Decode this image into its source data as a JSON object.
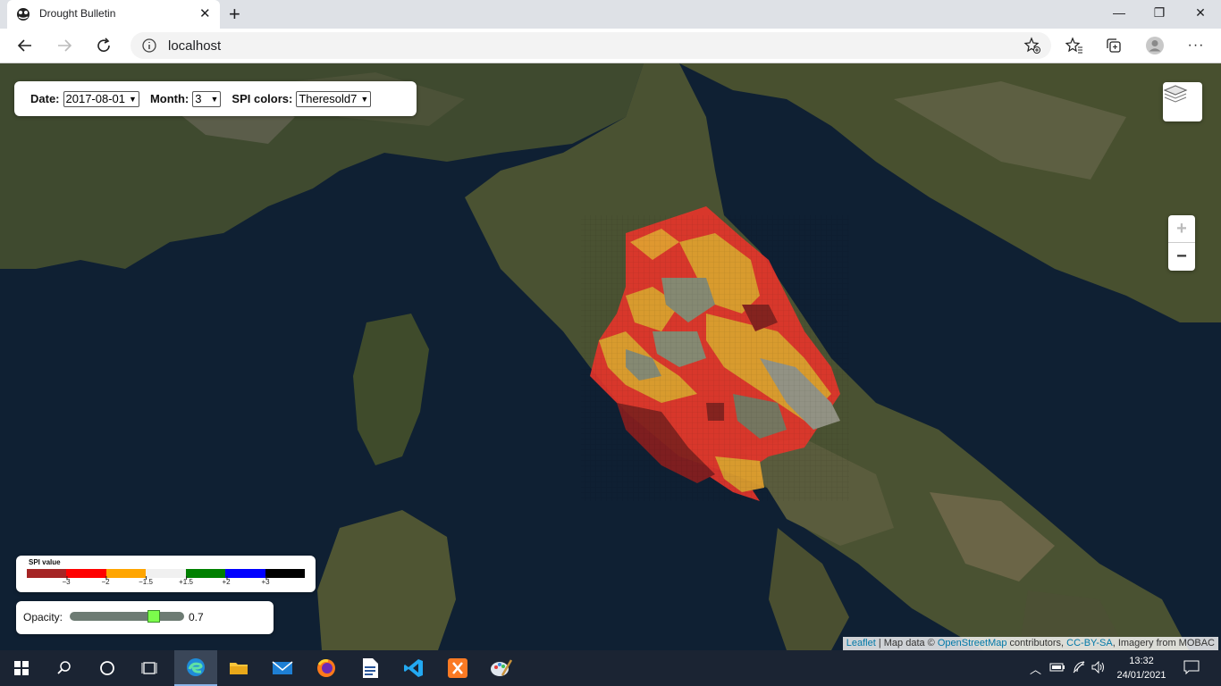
{
  "browser": {
    "tab_title": "Drought Bulletin",
    "address": "localhost"
  },
  "controls": {
    "date_label": "Date:",
    "date_value": "2017-08-01",
    "month_label": "Month:",
    "month_value": "3",
    "spi_label": "SPI colors:",
    "spi_value": "Theresold7"
  },
  "legend": {
    "title": "SPI value",
    "colors": [
      "#a52424",
      "#ff0000",
      "#ffa500",
      "#f0f0f0",
      "#008000",
      "#0000ff",
      "#000000"
    ],
    "ticks": [
      "−3",
      "−2",
      "−1.5",
      "+1.5",
      "+2",
      "+3"
    ]
  },
  "opacity": {
    "label": "Opacity:",
    "value": "0.7",
    "fraction": 0.7
  },
  "zoom": {
    "in": "+",
    "out": "−"
  },
  "attribution": {
    "leaflet": "Leaflet",
    "sep": " | Map data © ",
    "osm": "OpenStreetMap",
    "contrib": " contributors, ",
    "license": "CC-BY-SA",
    "imagery": ", Imagery from MOBAC"
  },
  "taskbar": {
    "time": "13:32",
    "date": "24/01/2021"
  },
  "icons": [
    "search-icon",
    "task-view-icon",
    "edge-icon",
    "folder-icon",
    "mail-icon",
    "firefox-icon",
    "word-icon",
    "vscode-icon",
    "xampp-icon",
    "paint-icon"
  ]
}
